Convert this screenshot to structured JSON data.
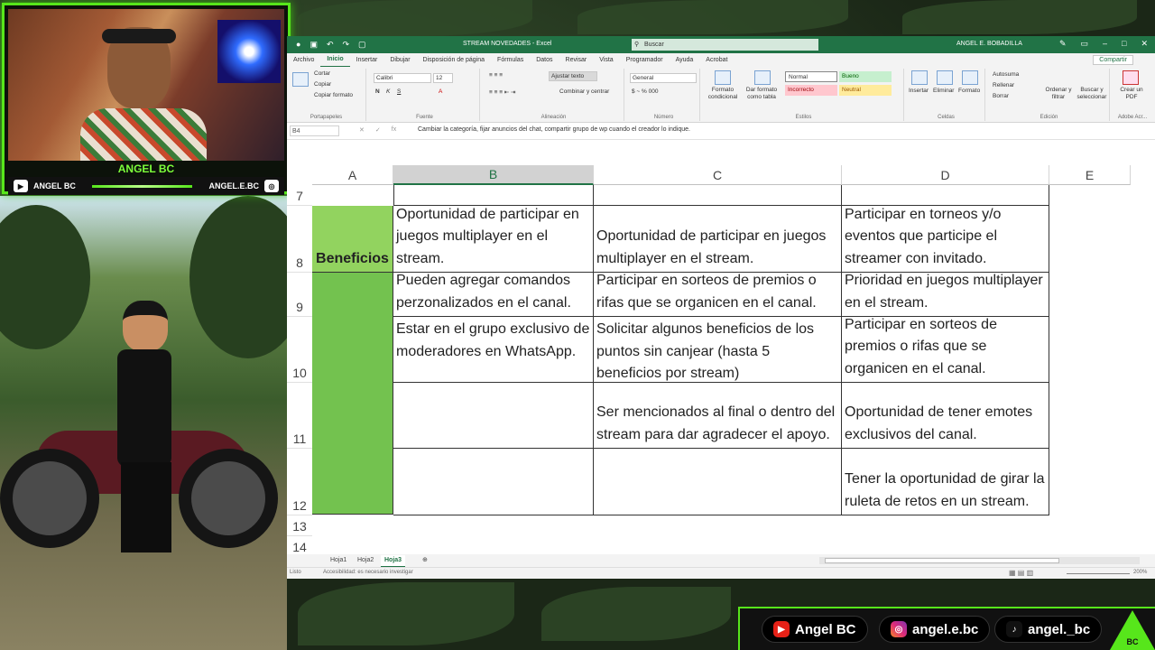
{
  "webcam": {
    "name": "ANGEL BC",
    "youtube_handle": "ANGEL BC",
    "instagram_handle": "ANGEL.E.BC"
  },
  "excel": {
    "title": "STREAM NOVEDADES - Excel",
    "search_placeholder": "Buscar",
    "user": "ANGEL E. BOBADILLA",
    "menu": [
      "Archivo",
      "Inicio",
      "Insertar",
      "Dibujar",
      "Disposición de página",
      "Fórmulas",
      "Datos",
      "Revisar",
      "Vista",
      "Programador",
      "Ayuda",
      "Acrobat"
    ],
    "active_menu": "Inicio",
    "share_label": "Compartir",
    "ribbon": {
      "groups": [
        "Portapapeles",
        "Fuente",
        "Alineación",
        "Número",
        "Estilos",
        "Celdas",
        "Edición",
        "Adobe Acr..."
      ],
      "paste_label": "Pegar",
      "cut_label": "Cortar",
      "copy_label": "Copiar",
      "format_painter_label": "Copiar formato",
      "font_name": "Calibri",
      "font_size": "12",
      "wrap_text_label": "Ajustar texto",
      "merge_label": "Combinar y centrar",
      "number_format": "General",
      "cond_format_label": "Formato condicional",
      "table_format_label": "Dar formato como tabla",
      "styles": {
        "normal": "Normal",
        "bueno": "Bueno",
        "incorrecto": "Incorrecto",
        "neutral": "Neutral"
      },
      "insert_label": "Insertar",
      "delete_label": "Eliminar",
      "format_label": "Formato",
      "autosum_label": "Autosuma",
      "fill_label": "Rellenar",
      "clear_label": "Borrar",
      "sort_label": "Ordenar y filtrar",
      "find_label": "Buscar y seleccionar",
      "pdf_label": "Crear un PDF"
    },
    "formula_bar": {
      "name_box": "B4",
      "formula": "Cambiar la categoría, fijar anuncios del chat, compartir grupo de wp cuando el creador lo indique."
    },
    "columns": [
      "A",
      "B",
      "C",
      "D",
      "E"
    ],
    "rows": [
      "7",
      "8",
      "9",
      "10",
      "11",
      "12",
      "13",
      "14"
    ],
    "category_label": "Beneficios",
    "cells": {
      "b8": "Oportunidad de participar en juegos multiplayer en el stream.",
      "c8": "Oportunidad de participar en juegos multiplayer en el stream.",
      "d8": "Participar en torneos y/o eventos que participe el streamer con invitado.",
      "b9": "Pueden agregar comandos perzonalizados en el canal.",
      "c9": "Participar en sorteos de premios o rifas que se organicen en el canal.",
      "d9": "Prioridad en juegos multiplayer en el stream.",
      "b10": "Estar en el grupo exclusivo de moderadores en WhatsApp.",
      "c10": "Solicitar algunos beneficios de los puntos sin canjear (hasta 5 beneficios por stream)",
      "d10": "Participar en sorteos de premios o rifas que se organicen en el canal.",
      "c11": "Ser mencionados al final o dentro del stream para dar agradecer el apoyo.",
      "d11": "Oportunidad de tener emotes exclusivos del canal.",
      "d12": "Tener la oportunidad de girar la ruleta de retos en un stream."
    },
    "sheets": [
      "Hoja1",
      "Hoja2",
      "Hoja3"
    ],
    "active_sheet": "Hoja3",
    "status": {
      "ready": "Listo",
      "accessibility": "Accesibilidad: es necesario investigar",
      "zoom": "200%"
    }
  },
  "banner": {
    "youtube": "Angel BC",
    "instagram": "angel.e.bc",
    "tiktok": "angel._bc",
    "logo_text": "BC"
  },
  "colors": {
    "excel_green": "#217346",
    "cell_green": "#73c24f",
    "accent_neon": "#57e61b"
  }
}
